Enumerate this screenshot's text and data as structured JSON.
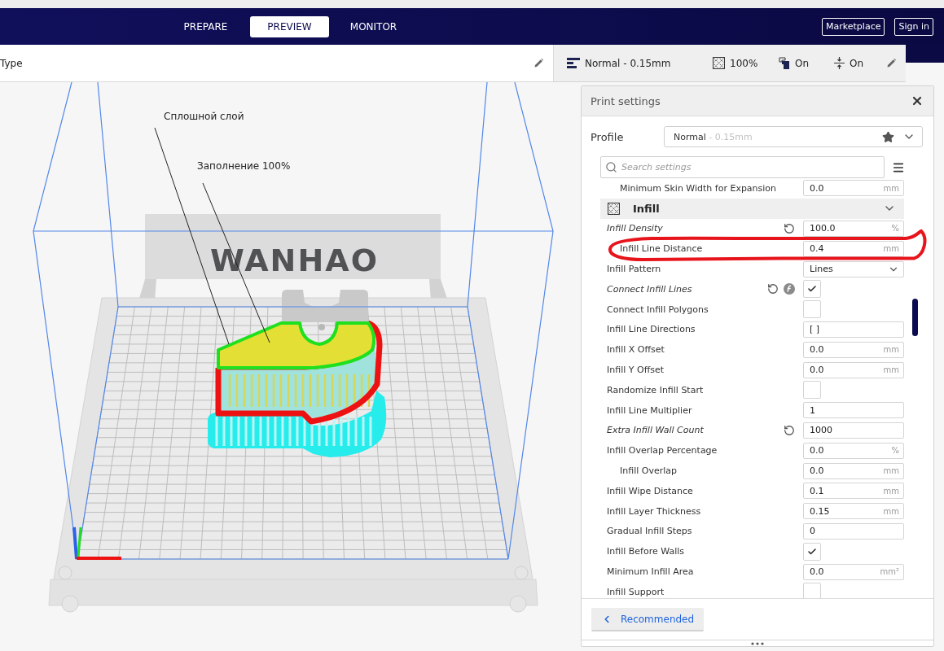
{
  "header": {
    "tabs": [
      {
        "label": "PREPARE",
        "selected": false
      },
      {
        "label": "PREVIEW",
        "selected": true
      },
      {
        "label": "MONITOR",
        "selected": false
      }
    ],
    "buttons": [
      "Marketplace",
      "Sign in"
    ]
  },
  "view_type": {
    "label": "Type"
  },
  "print_setup": {
    "items": [
      {
        "kind": "profile",
        "label": "Normal - 0.15mm"
      },
      {
        "kind": "infill",
        "label": "100%"
      },
      {
        "kind": "support",
        "label": "On"
      },
      {
        "kind": "adhesion",
        "label": "On"
      }
    ]
  },
  "viewport": {
    "printer_brand": "WANHAO",
    "annotations": [
      {
        "text": "Сплошной слой"
      },
      {
        "text": "Заполнение 100%"
      }
    ]
  },
  "print_settings": {
    "title": "Print settings",
    "profile": {
      "label": "Profile",
      "name": "Normal",
      "detail": "- 0.15mm"
    },
    "search": {
      "placeholder": "Search settings"
    },
    "settings": [
      {
        "children": [
          {
            "children": [
              {
                "label": "Minimum Skin Width for Expansion",
                "kind": "field",
                "value": "0.0",
                "unit": "mm",
                "modified": false
              }
            ]
          }
        ]
      },
      {
        "kind": "category",
        "label": "Infill",
        "expanded": true,
        "children": [
          {
            "label": "Infill Density",
            "kind": "field",
            "value": "100.0",
            "unit": "%",
            "modified": true,
            "children": [
              {
                "label": "Infill Line Distance",
                "kind": "field",
                "value": "0.4",
                "unit": "mm",
                "modified": false
              }
            ]
          },
          {
            "label": "Infill Pattern",
            "kind": "dropdown",
            "value": "Lines",
            "modified": false
          },
          {
            "label": "Connect Infill Lines",
            "kind": "checkbox",
            "checked": true,
            "modified": true,
            "overrides_formula": true
          },
          {
            "label": "Connect Infill Polygons",
            "kind": "checkbox",
            "checked": false,
            "modified": false
          },
          {
            "label": "Infill Line Directions",
            "kind": "field",
            "value": "[ ]",
            "modified": false
          },
          {
            "label": "Infill X Offset",
            "kind": "field",
            "value": "0.0",
            "unit": "mm",
            "modified": false
          },
          {
            "label": "Infill Y Offset",
            "kind": "field",
            "value": "0.0",
            "unit": "mm",
            "modified": false
          },
          {
            "label": "Randomize Infill Start",
            "kind": "checkbox",
            "checked": false,
            "modified": false
          },
          {
            "label": "Infill Line Multiplier",
            "kind": "field",
            "value": "1",
            "modified": false
          },
          {
            "label": "Extra Infill Wall Count",
            "kind": "field",
            "value": "1000",
            "modified": true
          },
          {
            "label": "Infill Overlap Percentage",
            "kind": "field",
            "value": "0.0",
            "unit": "%",
            "modified": false,
            "children": [
              {
                "label": "Infill Overlap",
                "kind": "field",
                "value": "0.0",
                "unit": "mm",
                "modified": false
              }
            ]
          },
          {
            "label": "Infill Wipe Distance",
            "kind": "field",
            "value": "0.1",
            "unit": "mm",
            "modified": false
          },
          {
            "label": "Infill Layer Thickness",
            "kind": "field",
            "value": "0.15",
            "unit": "mm",
            "modified": false
          },
          {
            "label": "Gradual Infill Steps",
            "kind": "field",
            "value": "0",
            "modified": false
          },
          {
            "label": "Infill Before Walls",
            "kind": "checkbox",
            "checked": true,
            "modified": false
          },
          {
            "label": "Minimum Infill Area",
            "kind": "field",
            "value": "0.0",
            "unit": "mm²",
            "modified": false
          },
          {
            "label": "Infill Support",
            "kind": "checkbox",
            "checked": false,
            "modified": false
          }
        ]
      }
    ],
    "footer_button": "Recommended"
  }
}
